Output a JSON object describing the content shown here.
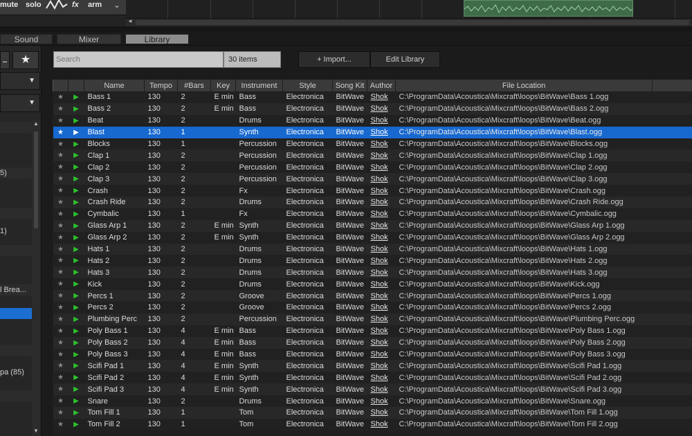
{
  "top_track": {
    "mute": "mute",
    "solo": "solo",
    "fx": "fx",
    "arm": "arm",
    "chevron": "⌄"
  },
  "tabs": [
    {
      "label": "Sound"
    },
    {
      "label": "Mixer"
    },
    {
      "label": "Library"
    }
  ],
  "sidebar": {
    "items": [
      {
        "label": ""
      },
      {
        "label": ""
      },
      {
        "label": "5)"
      },
      {
        "label": ""
      },
      {
        "label": ""
      },
      {
        "label": "1)"
      },
      {
        "label": ""
      },
      {
        "label": ""
      },
      {
        "label": "l Brea..."
      },
      {
        "label": ""
      },
      {
        "label": ""
      },
      {
        "label": ""
      },
      {
        "label": "pa (85)"
      },
      {
        "label": ""
      },
      {
        "label": ""
      }
    ]
  },
  "search": {
    "placeholder": "Search"
  },
  "items_count": "30 items",
  "buttons": {
    "import": "+ Import...",
    "edit_library": "Edit Library"
  },
  "columns": [
    "",
    "",
    "Name",
    "Tempo",
    "#Bars",
    "Key",
    "Instrument",
    "Style",
    "Song Kit",
    "Author",
    "File Location"
  ],
  "rows": [
    {
      "name": "Bass 1",
      "tempo": "130",
      "bars": "2",
      "key": "E min",
      "instrument": "Bass",
      "style": "Electronica",
      "kit": "BitWave",
      "author": "Shok",
      "loc": "C:\\ProgramData\\Acoustica\\Mixcraft\\loops\\BitWave\\Bass 1.ogg"
    },
    {
      "name": "Bass 2",
      "tempo": "130",
      "bars": "2",
      "key": "E min",
      "instrument": "Bass",
      "style": "Electronica",
      "kit": "BitWave",
      "author": "Shok",
      "loc": "C:\\ProgramData\\Acoustica\\Mixcraft\\loops\\BitWave\\Bass 2.ogg"
    },
    {
      "name": "Beat",
      "tempo": "130",
      "bars": "2",
      "key": "",
      "instrument": "Drums",
      "style": "Electronica",
      "kit": "BitWave",
      "author": "Shok",
      "loc": "C:\\ProgramData\\Acoustica\\Mixcraft\\loops\\BitWave\\Beat.ogg"
    },
    {
      "name": "Blast",
      "tempo": "130",
      "bars": "1",
      "key": "",
      "instrument": "Synth",
      "style": "Electronica",
      "kit": "BitWave",
      "author": "Shok",
      "loc": "C:\\ProgramData\\Acoustica\\Mixcraft\\loops\\BitWave\\Blast.ogg",
      "selected": true
    },
    {
      "name": "Blocks",
      "tempo": "130",
      "bars": "1",
      "key": "",
      "instrument": "Percussion",
      "style": "Electronica",
      "kit": "BitWave",
      "author": "Shok",
      "loc": "C:\\ProgramData\\Acoustica\\Mixcraft\\loops\\BitWave\\Blocks.ogg"
    },
    {
      "name": "Clap 1",
      "tempo": "130",
      "bars": "2",
      "key": "",
      "instrument": "Percussion",
      "style": "Electronica",
      "kit": "BitWave",
      "author": "Shok",
      "loc": "C:\\ProgramData\\Acoustica\\Mixcraft\\loops\\BitWave\\Clap 1.ogg"
    },
    {
      "name": "Clap 2",
      "tempo": "130",
      "bars": "2",
      "key": "",
      "instrument": "Percussion",
      "style": "Electronica",
      "kit": "BitWave",
      "author": "Shok",
      "loc": "C:\\ProgramData\\Acoustica\\Mixcraft\\loops\\BitWave\\Clap 2.ogg"
    },
    {
      "name": "Clap 3",
      "tempo": "130",
      "bars": "2",
      "key": "",
      "instrument": "Percussion",
      "style": "Electronica",
      "kit": "BitWave",
      "author": "Shok",
      "loc": "C:\\ProgramData\\Acoustica\\Mixcraft\\loops\\BitWave\\Clap 3.ogg"
    },
    {
      "name": "Crash",
      "tempo": "130",
      "bars": "2",
      "key": "",
      "instrument": "Fx",
      "style": "Electronica",
      "kit": "BitWave",
      "author": "Shok",
      "loc": "C:\\ProgramData\\Acoustica\\Mixcraft\\loops\\BitWave\\Crash.ogg"
    },
    {
      "name": "Crash Ride",
      "tempo": "130",
      "bars": "2",
      "key": "",
      "instrument": "Drums",
      "style": "Electronica",
      "kit": "BitWave",
      "author": "Shok",
      "loc": "C:\\ProgramData\\Acoustica\\Mixcraft\\loops\\BitWave\\Crash Ride.ogg"
    },
    {
      "name": "Cymbalic",
      "tempo": "130",
      "bars": "1",
      "key": "",
      "instrument": "Fx",
      "style": "Electronica",
      "kit": "BitWave",
      "author": "Shok",
      "loc": "C:\\ProgramData\\Acoustica\\Mixcraft\\loops\\BitWave\\Cymbalic.ogg"
    },
    {
      "name": "Glass Arp 1",
      "tempo": "130",
      "bars": "2",
      "key": "E min",
      "instrument": "Synth",
      "style": "Electronica",
      "kit": "BitWave",
      "author": "Shok",
      "loc": "C:\\ProgramData\\Acoustica\\Mixcraft\\loops\\BitWave\\Glass Arp 1.ogg"
    },
    {
      "name": "Glass Arp 2",
      "tempo": "130",
      "bars": "2",
      "key": "E min",
      "instrument": "Synth",
      "style": "Electronica",
      "kit": "BitWave",
      "author": "Shok",
      "loc": "C:\\ProgramData\\Acoustica\\Mixcraft\\loops\\BitWave\\Glass Arp 2.ogg"
    },
    {
      "name": "Hats 1",
      "tempo": "130",
      "bars": "2",
      "key": "",
      "instrument": "Drums",
      "style": "Electronica",
      "kit": "BitWave",
      "author": "Shok",
      "loc": "C:\\ProgramData\\Acoustica\\Mixcraft\\loops\\BitWave\\Hats 1.ogg"
    },
    {
      "name": "Hats 2",
      "tempo": "130",
      "bars": "2",
      "key": "",
      "instrument": "Drums",
      "style": "Electronica",
      "kit": "BitWave",
      "author": "Shok",
      "loc": "C:\\ProgramData\\Acoustica\\Mixcraft\\loops\\BitWave\\Hats 2.ogg"
    },
    {
      "name": "Hats 3",
      "tempo": "130",
      "bars": "2",
      "key": "",
      "instrument": "Drums",
      "style": "Electronica",
      "kit": "BitWave",
      "author": "Shok",
      "loc": "C:\\ProgramData\\Acoustica\\Mixcraft\\loops\\BitWave\\Hats 3.ogg"
    },
    {
      "name": "Kick",
      "tempo": "130",
      "bars": "2",
      "key": "",
      "instrument": "Drums",
      "style": "Electronica",
      "kit": "BitWave",
      "author": "Shok",
      "loc": "C:\\ProgramData\\Acoustica\\Mixcraft\\loops\\BitWave\\Kick.ogg"
    },
    {
      "name": "Percs 1",
      "tempo": "130",
      "bars": "2",
      "key": "",
      "instrument": "Groove",
      "style": "Electronica",
      "kit": "BitWave",
      "author": "Shok",
      "loc": "C:\\ProgramData\\Acoustica\\Mixcraft\\loops\\BitWave\\Percs 1.ogg"
    },
    {
      "name": "Percs 2",
      "tempo": "130",
      "bars": "2",
      "key": "",
      "instrument": "Groove",
      "style": "Electronica",
      "kit": "BitWave",
      "author": "Shok",
      "loc": "C:\\ProgramData\\Acoustica\\Mixcraft\\loops\\BitWave\\Percs 2.ogg"
    },
    {
      "name": "Plumbing Perc",
      "tempo": "130",
      "bars": "2",
      "key": "",
      "instrument": "Percussion",
      "style": "Electronica",
      "kit": "BitWave",
      "author": "Shok",
      "loc": "C:\\ProgramData\\Acoustica\\Mixcraft\\loops\\BitWave\\Plumbing Perc.ogg"
    },
    {
      "name": "Poly Bass 1",
      "tempo": "130",
      "bars": "4",
      "key": "E min",
      "instrument": "Bass",
      "style": "Electronica",
      "kit": "BitWave",
      "author": "Shok",
      "loc": "C:\\ProgramData\\Acoustica\\Mixcraft\\loops\\BitWave\\Poly Bass 1.ogg"
    },
    {
      "name": "Poly Bass 2",
      "tempo": "130",
      "bars": "4",
      "key": "E min",
      "instrument": "Bass",
      "style": "Electronica",
      "kit": "BitWave",
      "author": "Shok",
      "loc": "C:\\ProgramData\\Acoustica\\Mixcraft\\loops\\BitWave\\Poly Bass 2.ogg"
    },
    {
      "name": "Poly Bass 3",
      "tempo": "130",
      "bars": "4",
      "key": "E min",
      "instrument": "Bass",
      "style": "Electronica",
      "kit": "BitWave",
      "author": "Shok",
      "loc": "C:\\ProgramData\\Acoustica\\Mixcraft\\loops\\BitWave\\Poly Bass 3.ogg"
    },
    {
      "name": "Scifi Pad 1",
      "tempo": "130",
      "bars": "4",
      "key": "E min",
      "instrument": "Synth",
      "style": "Electronica",
      "kit": "BitWave",
      "author": "Shok",
      "loc": "C:\\ProgramData\\Acoustica\\Mixcraft\\loops\\BitWave\\Scifi Pad 1.ogg"
    },
    {
      "name": "Scifi Pad 2",
      "tempo": "130",
      "bars": "4",
      "key": "E min",
      "instrument": "Synth",
      "style": "Electronica",
      "kit": "BitWave",
      "author": "Shok",
      "loc": "C:\\ProgramData\\Acoustica\\Mixcraft\\loops\\BitWave\\Scifi Pad 2.ogg"
    },
    {
      "name": "Scifi Pad 3",
      "tempo": "130",
      "bars": "4",
      "key": "E min",
      "instrument": "Synth",
      "style": "Electronica",
      "kit": "BitWave",
      "author": "Shok",
      "loc": "C:\\ProgramData\\Acoustica\\Mixcraft\\loops\\BitWave\\Scifi Pad 3.ogg"
    },
    {
      "name": "Snare",
      "tempo": "130",
      "bars": "2",
      "key": "",
      "instrument": "Drums",
      "style": "Electronica",
      "kit": "BitWave",
      "author": "Shok",
      "loc": "C:\\ProgramData\\Acoustica\\Mixcraft\\loops\\BitWave\\Snare.ogg"
    },
    {
      "name": "Tom Fill 1",
      "tempo": "130",
      "bars": "1",
      "key": "",
      "instrument": "Tom",
      "style": "Electronica",
      "kit": "BitWave",
      "author": "Shok",
      "loc": "C:\\ProgramData\\Acoustica\\Mixcraft\\loops\\BitWave\\Tom Fill 1.ogg"
    },
    {
      "name": "Tom Fill 2",
      "tempo": "130",
      "bars": "1",
      "key": "",
      "instrument": "Tom",
      "style": "Electronica",
      "kit": "BitWave",
      "author": "Shok",
      "loc": "C:\\ProgramData\\Acoustica\\Mixcraft\\loops\\BitWave\\Tom Fill 2.ogg"
    }
  ],
  "icons": {
    "star": "★",
    "play": "▶",
    "favorites": "★",
    "dropdown": "⌄"
  },
  "colors": {
    "selection": "#1768cf",
    "play": "#2bc22b",
    "clip": "#3f6b48"
  }
}
